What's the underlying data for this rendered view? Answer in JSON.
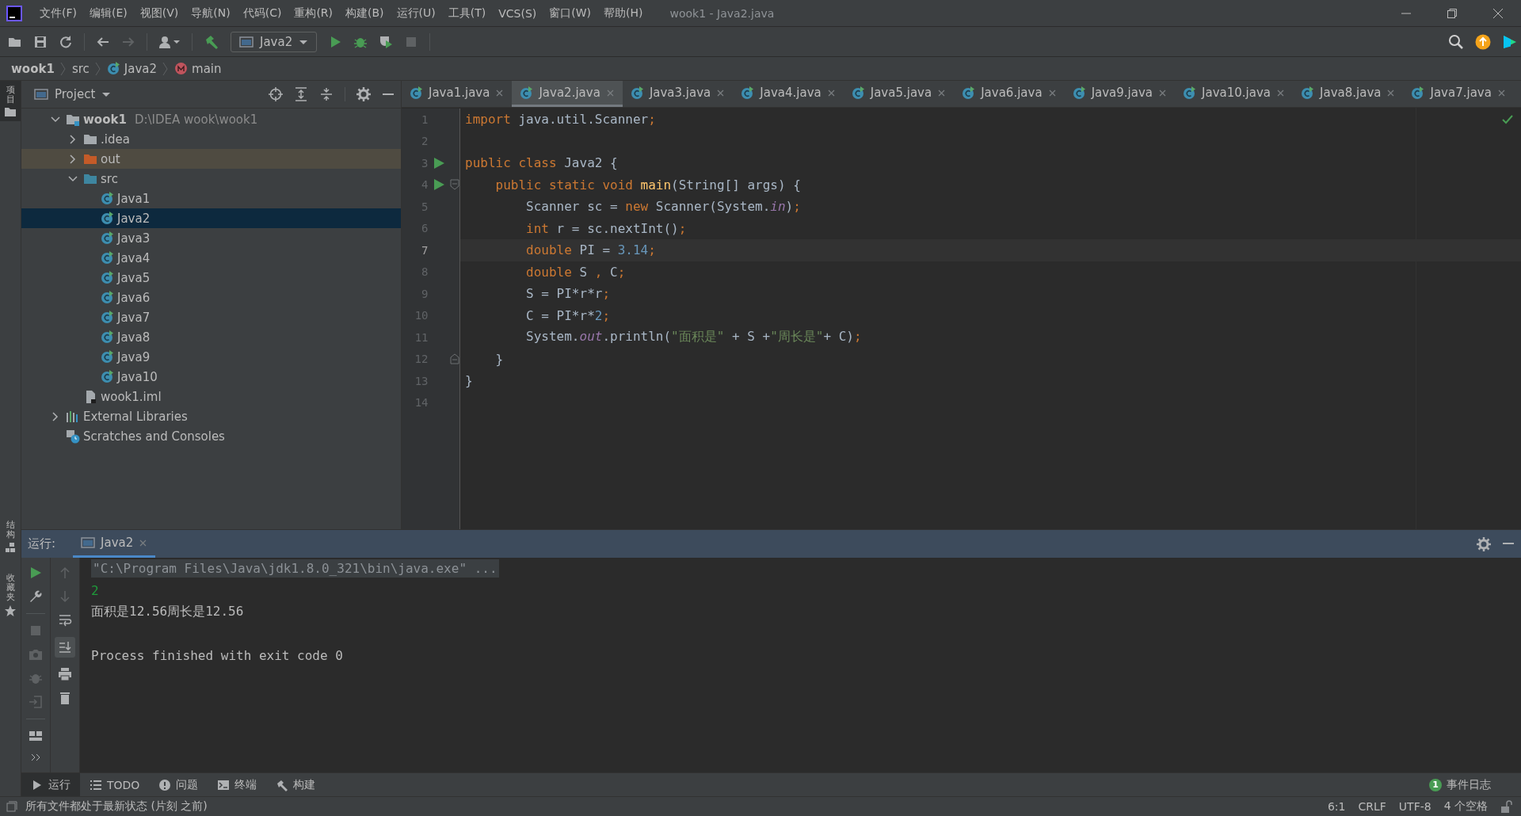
{
  "window": {
    "title": "wook1 - Java2.java"
  },
  "menu": [
    "文件(F)",
    "编辑(E)",
    "视图(V)",
    "导航(N)",
    "代码(C)",
    "重构(R)",
    "构建(B)",
    "运行(U)",
    "工具(T)",
    "VCS(S)",
    "窗口(W)",
    "帮助(H)"
  ],
  "toolbar": {
    "run_config": "Java2"
  },
  "breadcrumb": [
    {
      "label": "wook1",
      "kind": "module"
    },
    {
      "label": "src",
      "kind": "folder"
    },
    {
      "label": "Java2",
      "kind": "class"
    },
    {
      "label": "main",
      "kind": "method"
    }
  ],
  "left_strip_top": [
    {
      "label": "项目",
      "selected": true
    }
  ],
  "left_strip_bottom": [
    {
      "label": "结构",
      "kind": "structure"
    },
    {
      "label": "收藏夹",
      "kind": "favorites"
    }
  ],
  "project": {
    "title": "Project",
    "tree": [
      {
        "label": "wook1",
        "path": "D:\\IDEA wook\\wook1",
        "kind": "module",
        "expanded": true,
        "selected": false,
        "children": [
          {
            "label": ".idea",
            "kind": "folder",
            "expanded": false,
            "selected": false
          },
          {
            "label": "out",
            "kind": "excluded-folder",
            "expanded": false,
            "selected": false
          },
          {
            "label": "src",
            "kind": "source-folder",
            "expanded": true,
            "selected": false,
            "children": [
              {
                "label": "Java1",
                "kind": "class",
                "selected": false
              },
              {
                "label": "Java2",
                "kind": "class",
                "selected": true
              },
              {
                "label": "Java3",
                "kind": "class",
                "selected": false
              },
              {
                "label": "Java4",
                "kind": "class",
                "selected": false
              },
              {
                "label": "Java5",
                "kind": "class",
                "selected": false
              },
              {
                "label": "Java6",
                "kind": "class",
                "selected": false
              },
              {
                "label": "Java7",
                "kind": "class",
                "selected": false
              },
              {
                "label": "Java8",
                "kind": "class",
                "selected": false
              },
              {
                "label": "Java9",
                "kind": "class",
                "selected": false
              },
              {
                "label": "Java10",
                "kind": "class",
                "selected": false
              }
            ]
          },
          {
            "label": "wook1.iml",
            "kind": "iml",
            "selected": false
          }
        ]
      },
      {
        "label": "External Libraries",
        "kind": "libraries",
        "expanded": false,
        "selected": false
      },
      {
        "label": "Scratches and Consoles",
        "kind": "scratches",
        "selected": false
      }
    ]
  },
  "editor": {
    "tabs": [
      {
        "label": "Java1.java",
        "selected": false
      },
      {
        "label": "Java2.java",
        "selected": true
      },
      {
        "label": "Java3.java",
        "selected": false
      },
      {
        "label": "Java4.java",
        "selected": false
      },
      {
        "label": "Java5.java",
        "selected": false
      },
      {
        "label": "Java6.java",
        "selected": false
      },
      {
        "label": "Java9.java",
        "selected": false
      },
      {
        "label": "Java10.java",
        "selected": false
      },
      {
        "label": "Java8.java",
        "selected": false
      },
      {
        "label": "Java7.java",
        "selected": false
      }
    ],
    "lines": [
      {
        "number": "1",
        "current": false,
        "tokens": [
          {
            "kind": "keyword",
            "text": "import"
          },
          {
            "kind": "plain",
            "text": " java.util.Scanner"
          },
          {
            "kind": "keyword",
            "text": ";"
          }
        ]
      },
      {
        "number": "2",
        "current": false
      },
      {
        "number": "3",
        "current": false,
        "run_marker": true,
        "tokens": [
          {
            "kind": "keyword",
            "text": "public class"
          },
          {
            "kind": "plain",
            "text": " Java2 {"
          }
        ]
      },
      {
        "number": "4",
        "current": false,
        "run_marker": true,
        "fold_start": true,
        "tokens": [
          {
            "kind": "keyword",
            "text": "    public static void "
          },
          {
            "kind": "method",
            "text": "main"
          },
          {
            "kind": "plain",
            "text": "(String[] args) {"
          }
        ]
      },
      {
        "number": "5",
        "current": false,
        "tokens": [
          {
            "kind": "plain",
            "text": "        Scanner sc = "
          },
          {
            "kind": "keyword",
            "text": "new"
          },
          {
            "kind": "plain",
            "text": " Scanner(System."
          },
          {
            "kind": "static",
            "text": "in"
          },
          {
            "kind": "plain",
            "text": ")"
          },
          {
            "kind": "keyword",
            "text": ";"
          }
        ]
      },
      {
        "number": "6",
        "current": false,
        "tokens": [
          {
            "kind": "keyword",
            "text": "        int"
          },
          {
            "kind": "plain",
            "text": " r = sc.nextInt()"
          },
          {
            "kind": "keyword",
            "text": ";"
          }
        ]
      },
      {
        "number": "7",
        "current": true,
        "tokens": [
          {
            "kind": "keyword",
            "text": "        double"
          },
          {
            "kind": "plain",
            "text": " PI = "
          },
          {
            "kind": "number",
            "text": "3.14"
          },
          {
            "kind": "keyword",
            "text": ";"
          }
        ]
      },
      {
        "number": "8",
        "current": false,
        "tokens": [
          {
            "kind": "keyword",
            "text": "        double"
          },
          {
            "kind": "plain",
            "text": " S "
          },
          {
            "kind": "keyword",
            "text": ","
          },
          {
            "kind": "plain",
            "text": " C"
          },
          {
            "kind": "keyword",
            "text": ";"
          }
        ]
      },
      {
        "number": "9",
        "current": false,
        "tokens": [
          {
            "kind": "plain",
            "text": "        S = PI*r*r"
          },
          {
            "kind": "keyword",
            "text": ";"
          }
        ]
      },
      {
        "number": "10",
        "current": false,
        "tokens": [
          {
            "kind": "plain",
            "text": "        C = PI*r*"
          },
          {
            "kind": "number",
            "text": "2"
          },
          {
            "kind": "keyword",
            "text": ";"
          }
        ]
      },
      {
        "number": "11",
        "current": false,
        "tokens": [
          {
            "kind": "plain",
            "text": "        System."
          },
          {
            "kind": "static",
            "text": "out"
          },
          {
            "kind": "plain",
            "text": ".println("
          },
          {
            "kind": "string",
            "text": "\"面积是\""
          },
          {
            "kind": "plain",
            "text": " + S +"
          },
          {
            "kind": "string",
            "text": "\"周长是\""
          },
          {
            "kind": "plain",
            "text": "+ C)"
          },
          {
            "kind": "keyword",
            "text": ";"
          }
        ]
      },
      {
        "number": "12",
        "current": false,
        "fold_end": true,
        "tokens": [
          {
            "kind": "plain",
            "text": "    }"
          }
        ]
      },
      {
        "number": "13",
        "current": false,
        "tokens": [
          {
            "kind": "plain",
            "text": "}"
          }
        ]
      },
      {
        "number": "14",
        "current": false
      }
    ]
  },
  "run": {
    "label": "运行:",
    "tabs": [
      {
        "label": "Java2",
        "selected": true
      }
    ],
    "console": [
      {
        "kind": "command",
        "text": "\"C:\\Program Files\\Java\\jdk1.8.0_321\\bin\\java.exe\" ..."
      },
      {
        "kind": "input",
        "text": "2"
      },
      {
        "kind": "output",
        "text": "面积是12.56周长是12.56"
      },
      {
        "kind": "exit",
        "text": "Process finished with exit code 0"
      }
    ]
  },
  "tool_tabs": [
    {
      "label": "运行",
      "kind": "run",
      "selected": true
    },
    {
      "label": "TODO",
      "kind": "todo",
      "selected": false
    },
    {
      "label": "问题",
      "kind": "problems",
      "selected": false
    },
    {
      "label": "终端",
      "kind": "terminal",
      "selected": false
    },
    {
      "label": "构建",
      "kind": "build",
      "selected": false
    }
  ],
  "event_log": {
    "count": "1",
    "label": "事件日志"
  },
  "status_bar": {
    "message": "所有文件都处于最新状态 (片刻 之前)",
    "items": [
      "6:1",
      "CRLF",
      "UTF-8",
      "4 个空格"
    ]
  }
}
